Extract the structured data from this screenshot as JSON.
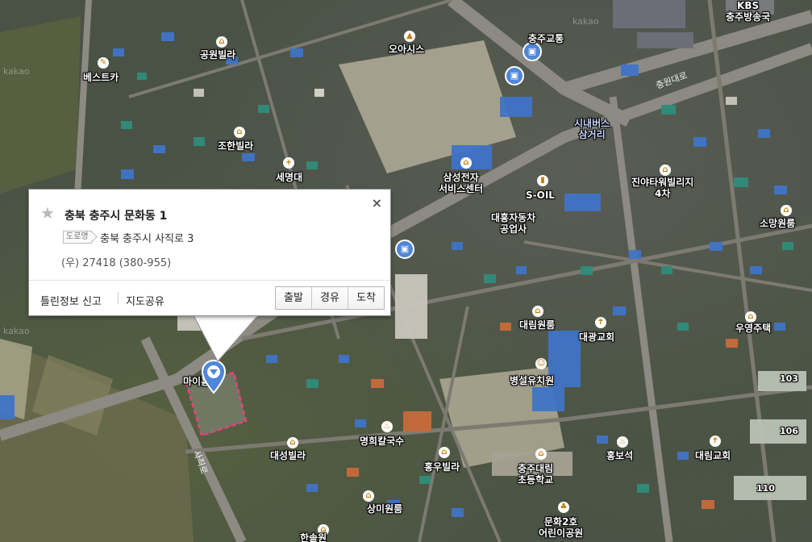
{
  "map": {
    "watermark": "kakao",
    "labels": {
      "kbs": "KBS\n충주방송국",
      "chungju_bridge": "충주교통",
      "oasis": "오아시스",
      "gongwon_villa": "공원빌라",
      "best_car": "베스트카",
      "johan_villa": "조한빌라",
      "semyeong": "세명대",
      "samsung_service": "삼성전자\n서비스센터",
      "s_oil": "S-OIL",
      "daeheung_motors": "대흥자동차\n공업사",
      "jinya_tower": "진야타워빌리지\n4차",
      "somang_won": "소망원룸",
      "sinae_bus": "시내버스\n삼거리",
      "daerim_room": "대림원룸",
      "daegwang_church": "대광교회",
      "uyeong_house": "우영주택",
      "byeongseol_kinder": "병설유치원",
      "mai_home": "마이홈",
      "daeseong_villa": "대성빌라",
      "myeonghui_noodle": "명희칼국수",
      "hongwoo_villa": "홍우빌라",
      "hongbo_seok": "홍보석",
      "daerim_church": "대림교회",
      "chungju_daerim_school": "충주대림\n초등학교",
      "sangmi_room": "상미원룸",
      "munhwa_park": "문화2호\n어린이공원",
      "hansol": "한솔원",
      "apt103": "103",
      "apt106": "106",
      "apt110": "110",
      "road_sajik": "사직로",
      "road_daero": "충원대로"
    }
  },
  "popup": {
    "title": "충북 충주시 문화동 1",
    "road_tag": "도로명",
    "road_address": "충북 충주시 사직로 3",
    "zip": "(우) 27418 (380-955)",
    "report_link": "틀린정보 신고",
    "share_link": "지도공유",
    "buttons": [
      "출발",
      "경유",
      "도착"
    ],
    "close_glyph": "×",
    "star_glyph": "★"
  },
  "colors": {
    "roof_blue": "#3f74c7",
    "roof_teal": "#2f8c7a",
    "road": "#8f8c83",
    "highlight_area": "#e0447f",
    "marker": "#4f86d9"
  }
}
